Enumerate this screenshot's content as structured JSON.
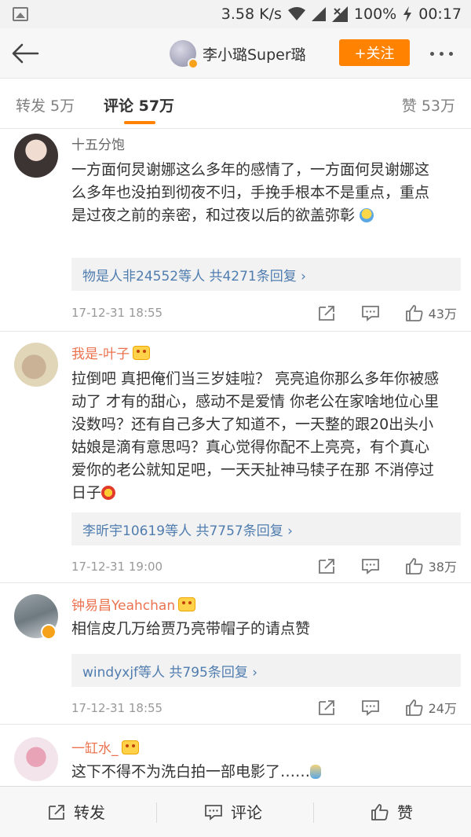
{
  "status_bar": {
    "speed": "3.58 K/s",
    "battery": "100%",
    "time": "00:17",
    "icons": [
      "image-icon",
      "wifi-icon",
      "signal-icon",
      "no-sim-signal-icon",
      "charging-icon"
    ]
  },
  "header": {
    "user_name": "李小璐Super璐",
    "follow_label": "+关注",
    "icons": [
      "back-arrow-icon",
      "more-dots-icon"
    ]
  },
  "tabs": {
    "repost": "转发 5万",
    "comments": "评论 57万",
    "likes": "赞 53万"
  },
  "accent_color": "#ff8200",
  "comments": [
    {
      "user": "十五分饱",
      "text": "一方面何炅谢娜这么多年的感情了，一方面何炅谢娜这么多年也没拍到彻夜不归，手挽手根本不是重点，重点是过夜之前的亲密，和过夜以后的欲盖弥彰",
      "replies": "物是人非24552等人 共4271条回复 ›",
      "time": "17-12-31 18:55",
      "likes": "43万"
    },
    {
      "user": "我是-叶子",
      "text": "拉倒吧 真把俺们当三岁娃啦？ 亮亮追你那么多年你被感动了 才有的甜心，感动不是爱情 你老公在家啥地位心里没数吗？还有自己多大了知道不，一天整的跟20出头小姑娘是滴有意思吗？真心觉得你配不上亮亮，有个真心爱你的老公就知足吧，一天天扯神马犊子在那 不消停过日子",
      "replies": "李昕宇10619等人 共7757条回复 ›",
      "time": "17-12-31 19:00",
      "likes": "38万"
    },
    {
      "user": "钟易昌Yeahchan",
      "text": "相信皮几万给贾乃亮带帽子的请点赞",
      "replies": "windyxjf等人 共795条回复 ›",
      "time": "17-12-31 18:55",
      "likes": "24万"
    },
    {
      "user": "一缸水_",
      "text": "这下不得不为洗白拍一部电影了……"
    }
  ],
  "bottom_bar": {
    "repost": "转发",
    "comment": "评论",
    "like": "赞"
  }
}
